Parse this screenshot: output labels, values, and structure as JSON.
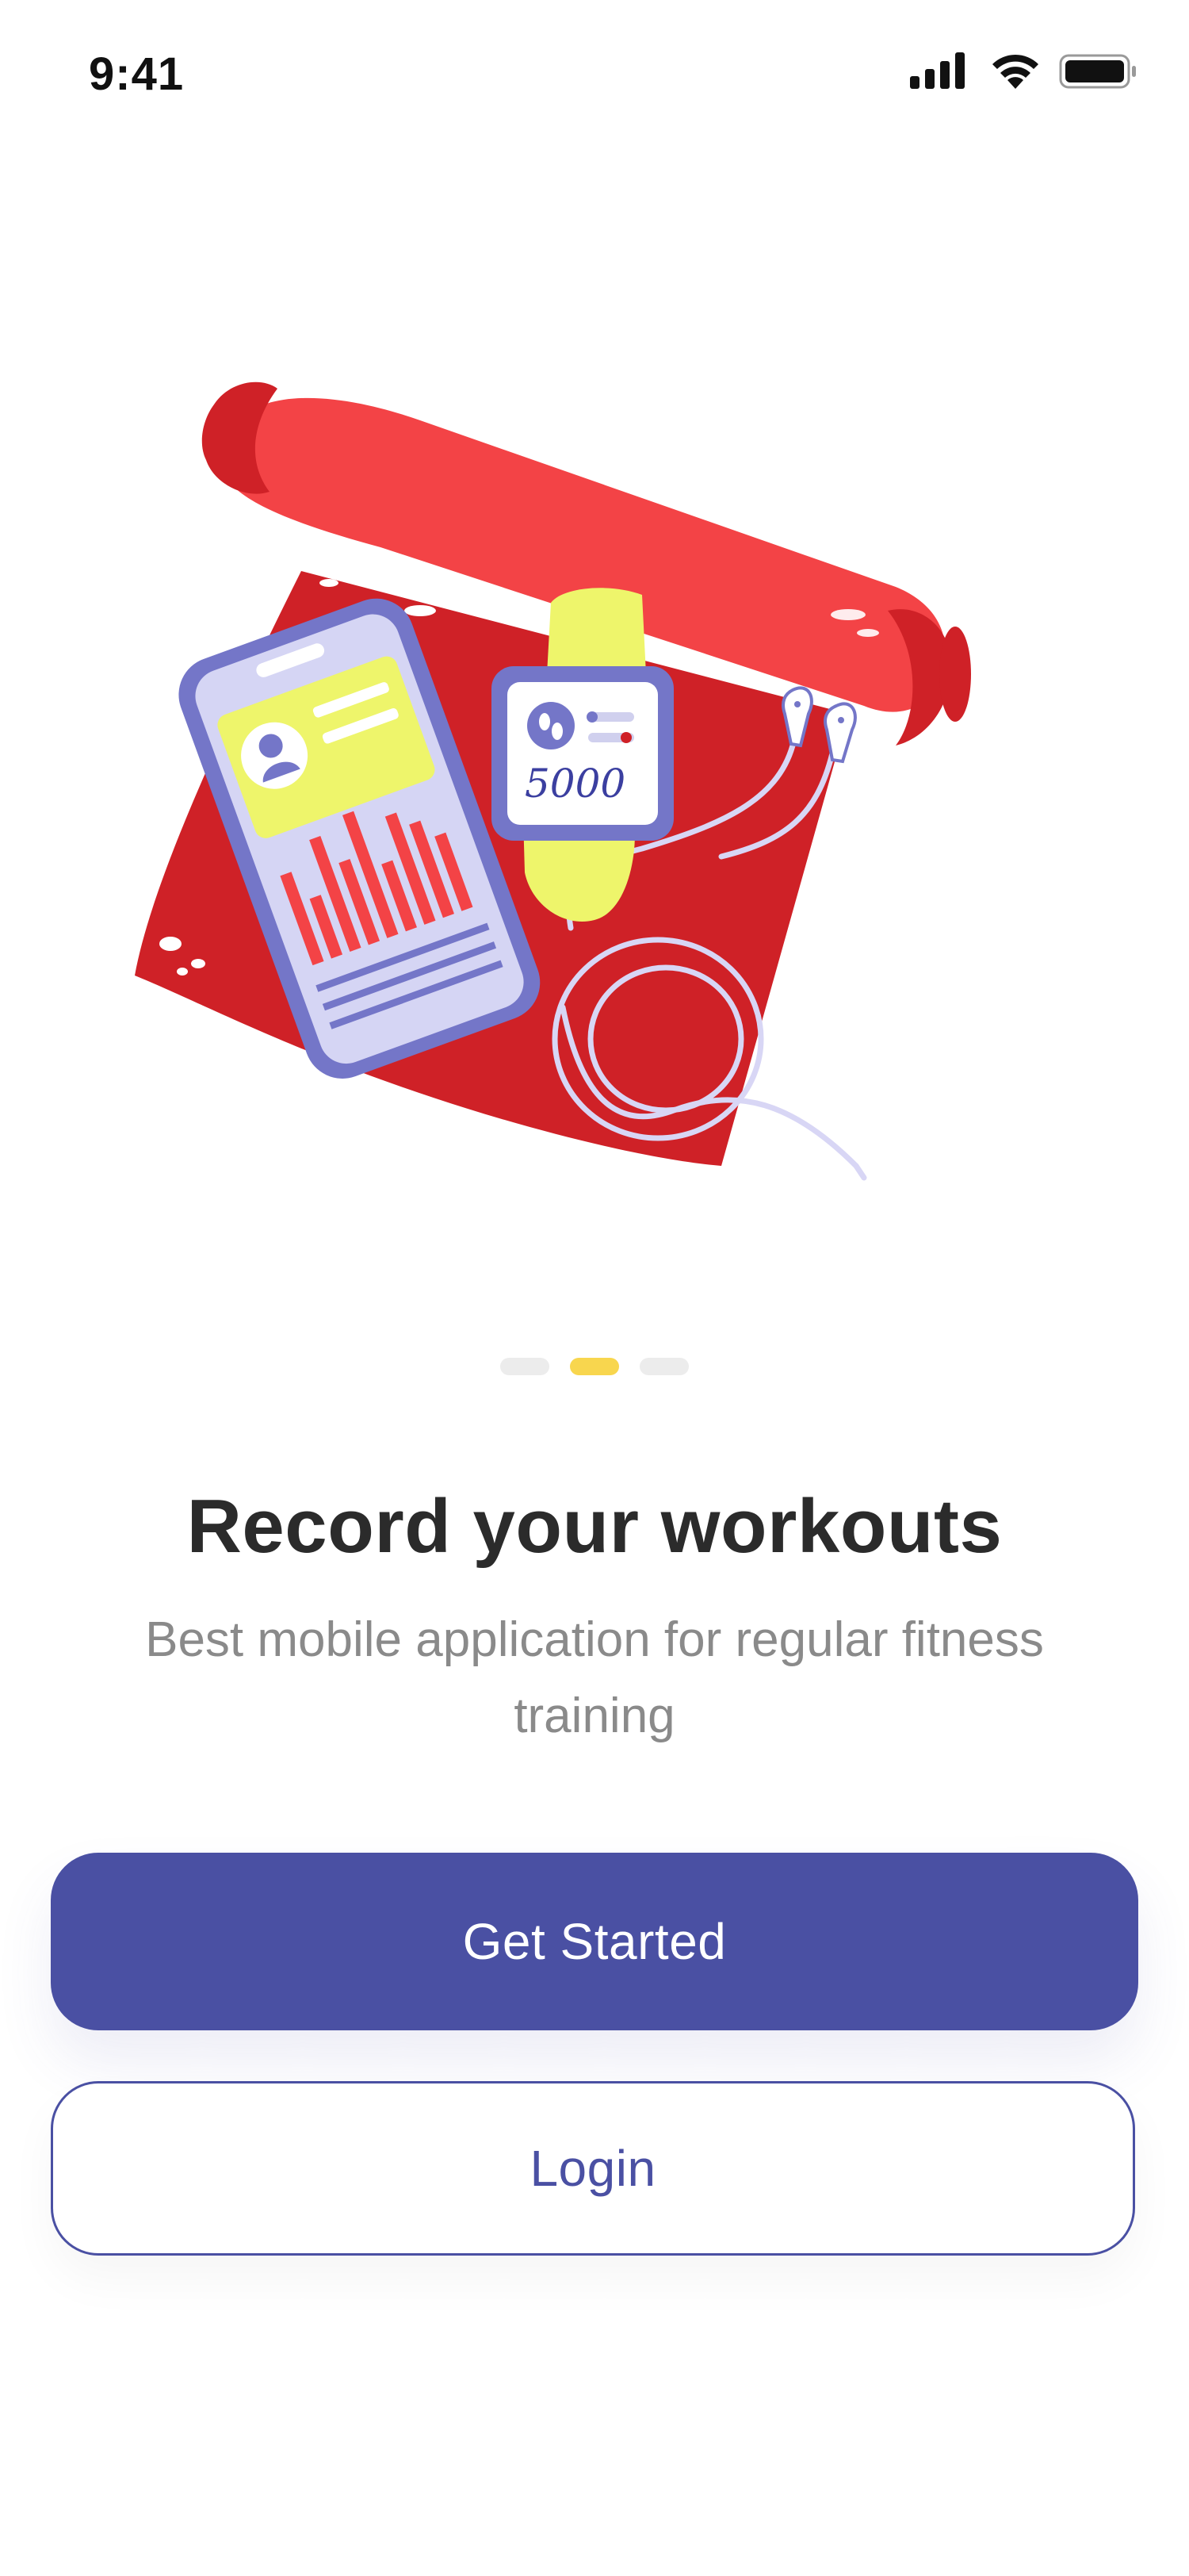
{
  "status_bar": {
    "time": "9:41"
  },
  "onboarding": {
    "pager": {
      "count": 3,
      "active_index": 1
    },
    "title": "Record your workouts",
    "subtitle": "Best mobile application for regular fitness training",
    "illustration": {
      "watch_text": "5000"
    }
  },
  "actions": {
    "primary_label": "Get Started",
    "secondary_label": "Login"
  },
  "colors": {
    "primary": "#4a50a3",
    "accent_yellow": "#f8d64e",
    "mat_red": "#d02127",
    "title_text": "#2b2b2b",
    "subtitle_text": "#8a8a8a"
  },
  "icons": [
    "cellular-signal-icon",
    "wifi-icon",
    "battery-icon"
  ]
}
